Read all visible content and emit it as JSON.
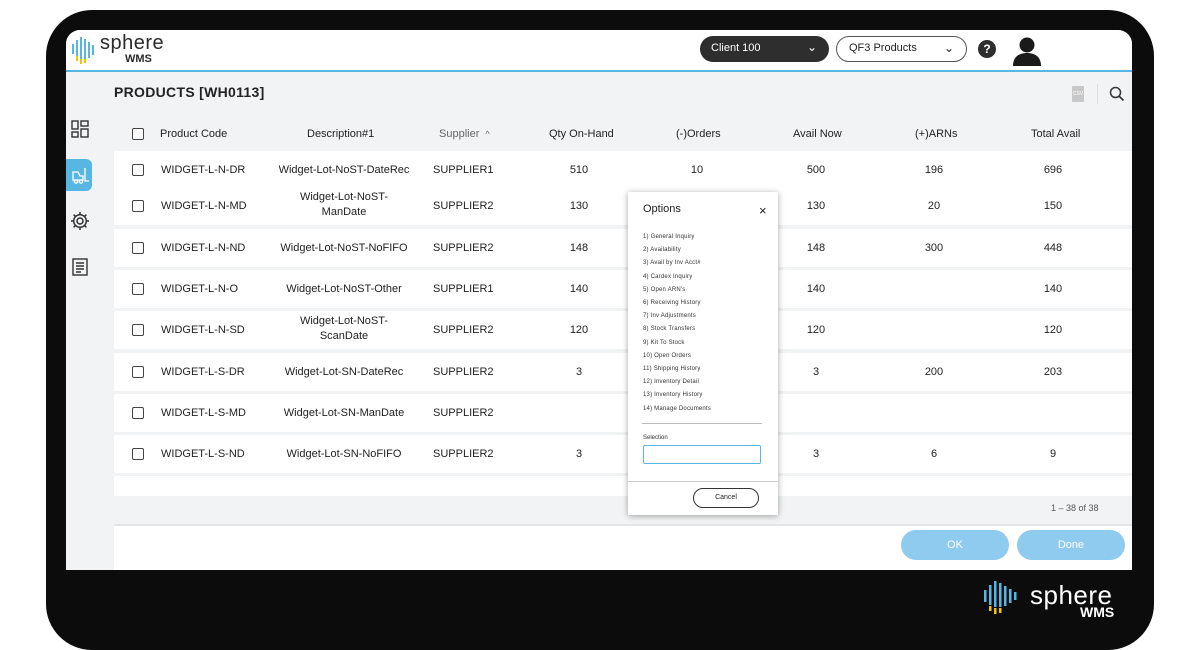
{
  "app": {
    "logo_text": "sphere",
    "logo_sub": "WMS"
  },
  "header": {
    "client_select": "Client 100",
    "product_select": "QF3 Products",
    "help_label": "?"
  },
  "page": {
    "title": "PRODUCTS [WH0113]",
    "csv_label": "CSV"
  },
  "table": {
    "columns": [
      "Product Code",
      "Description#1",
      "Supplier",
      "Qty On-Hand",
      "(-)Orders",
      "Avail Now",
      "(+)ARNs",
      "Total Avail"
    ],
    "sort_indicator": "^",
    "rows": [
      {
        "code": "WIDGET-L-N-DR",
        "desc1": "Widget-Lot-NoST-DateRec",
        "desc2": "",
        "supplier": "SUPPLIER1",
        "qty": "510",
        "orders": "10",
        "avail": "500",
        "arns": "196",
        "total": "696"
      },
      {
        "code": "WIDGET-L-N-MD",
        "desc1": "Widget-Lot-NoST-",
        "desc2": "ManDate",
        "supplier": "SUPPLIER2",
        "qty": "130",
        "orders": "",
        "avail": "130",
        "arns": "20",
        "total": "150"
      },
      {
        "code": "WIDGET-L-N-ND",
        "desc1": "Widget-Lot-NoST-NoFIFO",
        "desc2": "",
        "supplier": "SUPPLIER2",
        "qty": "148",
        "orders": "",
        "avail": "148",
        "arns": "300",
        "total": "448"
      },
      {
        "code": "WIDGET-L-N-O",
        "desc1": "Widget-Lot-NoST-Other",
        "desc2": "",
        "supplier": "SUPPLIER1",
        "qty": "140",
        "orders": "",
        "avail": "140",
        "arns": "",
        "total": "140"
      },
      {
        "code": "WIDGET-L-N-SD",
        "desc1": "Widget-Lot-NoST-",
        "desc2": "ScanDate",
        "supplier": "SUPPLIER2",
        "qty": "120",
        "orders": "",
        "avail": "120",
        "arns": "",
        "total": "120"
      },
      {
        "code": "WIDGET-L-S-DR",
        "desc1": "Widget-Lot-SN-DateRec",
        "desc2": "",
        "supplier": "SUPPLIER2",
        "qty": "3",
        "orders": "",
        "avail": "3",
        "arns": "200",
        "total": "203"
      },
      {
        "code": "WIDGET-L-S-MD",
        "desc1": "Widget-Lot-SN-ManDate",
        "desc2": "",
        "supplier": "SUPPLIER2",
        "qty": "",
        "orders": "",
        "avail": "",
        "arns": "",
        "total": ""
      },
      {
        "code": "WIDGET-L-S-ND",
        "desc1": "Widget-Lot-SN-NoFIFO",
        "desc2": "",
        "supplier": "SUPPLIER2",
        "qty": "3",
        "orders": "",
        "avail": "3",
        "arns": "6",
        "total": "9"
      }
    ],
    "pagination": "1 – 38 of 38"
  },
  "options_dialog": {
    "title": "Options",
    "close_label": "×",
    "items": [
      "1) General Inquiry",
      "2) Availability",
      "3) Avail by Inv Acct#",
      "4) Cardex Inquiry",
      "5) Open ARN's",
      "6) Receiving History",
      "7) Inv Adjustments",
      "8) Stock Transfers",
      "9) Kit To Stock",
      "10) Open Orders",
      "11) Shipping History",
      "12) Inventory Detail",
      "13) Inventory History",
      "14) Manage Documents"
    ],
    "selection_label": "Selection",
    "selection_value": "",
    "cancel_label": "Cancel"
  },
  "actions": {
    "ok_label": "OK",
    "done_label": "Done"
  },
  "footer": {
    "logo_text": "sphere",
    "logo_sub": "WMS"
  },
  "colors": {
    "accent": "#58b6e2",
    "button": "#8fcaef",
    "dark": "#2e2e2e"
  },
  "icons": [
    "dashboard-icon",
    "forklift-icon",
    "gear-icon",
    "report-icon",
    "toggle-icon",
    "search-icon",
    "csv-icon",
    "avatar-icon",
    "chevron-down-icon"
  ]
}
